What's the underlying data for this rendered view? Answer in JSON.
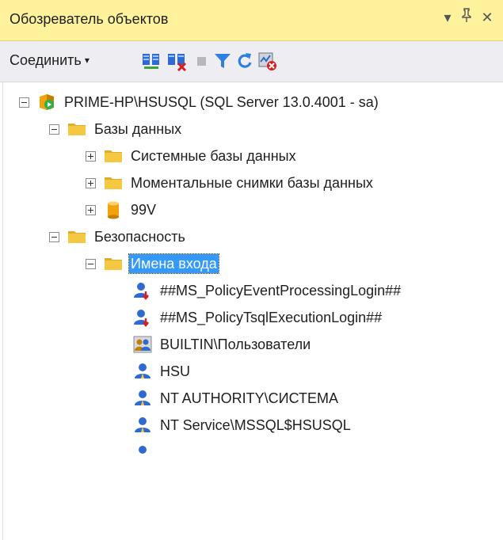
{
  "panel": {
    "title": "Обозреватель объектов",
    "pin_glyph": "ᵖ",
    "dropdown_glyph": "▾",
    "close_glyph": "✕"
  },
  "toolbar": {
    "connect_label": "Соединить",
    "connect_caret": "▾",
    "icons": [
      "connect-object-explorer-icon",
      "disconnect-icon",
      "stop-icon",
      "filter-icon",
      "refresh-icon",
      "activity-monitor-icon"
    ]
  },
  "tree": {
    "server": "PRIME-HP\\HSUSQL (SQL Server 13.0.4001 - sa)",
    "databases": "Базы данных",
    "system_databases": "Системные базы данных",
    "snapshots": "Моментальные снимки базы данных",
    "db_99v": "99V",
    "security": "Безопасность",
    "logins": "Имена входа",
    "login_items": [
      "##MS_PolicyEventProcessingLogin##",
      "##MS_PolicyTsqlExecutionLogin##",
      "BUILTIN\\Пользователи",
      "HSU",
      "NT AUTHORITY\\СИСТЕМА",
      "NT Service\\MSSQL$HSUSQL"
    ]
  },
  "colors": {
    "title_bg": "#fff29d",
    "toolbar_bg": "#eeeef2",
    "selection": "#3399ff",
    "folder": "#f5c842"
  }
}
